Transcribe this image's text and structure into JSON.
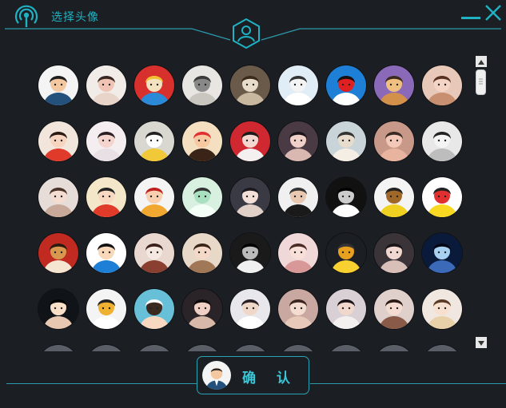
{
  "window": {
    "title": "选择头像",
    "icons": {
      "app": "broadcast-tower-icon",
      "minimize": "minimize-icon",
      "close": "close-icon",
      "emblem": "user-hexagon-icon"
    },
    "accent_color": "#1fb2c3",
    "background_color": "#1b1e23"
  },
  "avatars": {
    "rows": [
      [
        "man-in-suit-cartoon",
        "girl-illustration",
        "doraemon-crown",
        "ink-landscape",
        "cat-photo",
        "white-cartoon-dog",
        "doraemon-face",
        "jerry-mouse",
        "girl-pink-hair"
      ],
      [
        "girl-red-collar",
        "boy-anime-sketch",
        "yellow-cartoon-cat",
        "cartoon-boy-face",
        "anime-girl-red",
        "girl-photo-dark",
        "white-puppy",
        "pig-photo",
        "boy-sketch-bw"
      ],
      [
        "girl-long-hair",
        "chinese-doll-cartoon",
        "cartoon-girl-hat",
        "cute-ghost-cartoon",
        "boy-anime-dark",
        "man-in-tux",
        "black-white-portrait",
        "spongebob",
        "pikachu"
      ],
      [
        "lion-red-frame",
        "doraemon-nobita",
        "girl-with-dog",
        "girl-short-hair",
        "girl-black-bw",
        "girl-pink-blush",
        "laughing-emoji",
        "girl-bangs",
        "starry-night-silhouette"
      ],
      [
        "girl-crown-dark",
        "white-duck-cartoon",
        "boy-blue-bg",
        "girl-dark-hair",
        "girl-white-shirt",
        "girl-selfie",
        "girl-long-black",
        "girl-curly",
        "girl-sun-hat"
      ],
      [
        "partial-1",
        "partial-2",
        "partial-3",
        "partial-4",
        "partial-5",
        "partial-6",
        "partial-7",
        "partial-8",
        "partial-9"
      ]
    ]
  },
  "scrollbar": {
    "position_fraction": 0.0
  },
  "confirm": {
    "label": "确 认",
    "avatar": "man-in-suit-cartoon"
  }
}
